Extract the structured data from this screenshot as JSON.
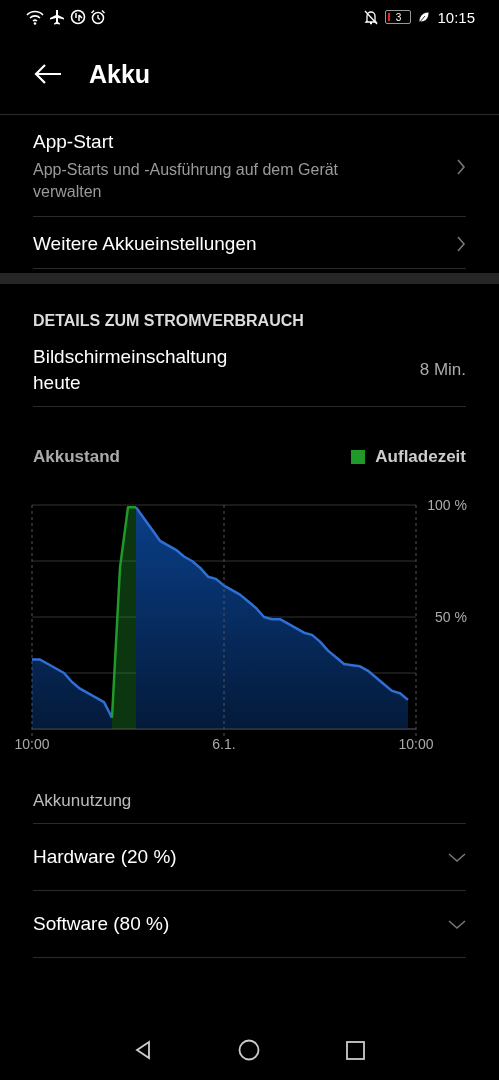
{
  "status_bar": {
    "time": "10:15",
    "battery": "3"
  },
  "header": {
    "title": "Akku"
  },
  "settings": [
    {
      "title": "App-Start",
      "subtitle": "App-Starts und -Ausführung auf dem Gerät verwalten"
    },
    {
      "title": "Weitere Akkueinstellungen"
    }
  ],
  "details": {
    "heading": "DETAILS ZUM STROMVERBRAUCH",
    "screen_on": {
      "label": "Bildschirmeinschaltung heute",
      "value": "8 Min."
    }
  },
  "battery_chart": {
    "chart_data": {
      "type": "area",
      "title": "Akkustand",
      "categories": [
        "10:00",
        null,
        null,
        null,
        null,
        null,
        null,
        null,
        null,
        null,
        null,
        null,
        null,
        null,
        null,
        null,
        null,
        null,
        null,
        null,
        null,
        null,
        null,
        null,
        "6.1.",
        null,
        null,
        null,
        null,
        null,
        null,
        null,
        null,
        null,
        null,
        null,
        null,
        null,
        null,
        null,
        null,
        null,
        null,
        null,
        null,
        null,
        null,
        null,
        "10:00"
      ],
      "series": [
        {
          "color": "#2f6fd6",
          "values": [
            31,
            31,
            29,
            27,
            25,
            21,
            18,
            16,
            14,
            12,
            5,
            null,
            null,
            99,
            94,
            89,
            84,
            82,
            80,
            77,
            75,
            72,
            68,
            67,
            64,
            62,
            60,
            57,
            54,
            50,
            49,
            49,
            47,
            45,
            43,
            42,
            39,
            35,
            32,
            29,
            28.5,
            28,
            26,
            23,
            20,
            17,
            16,
            13,
            null
          ]
        },
        {
          "name": "Aufladezeit",
          "color": "#1f9a2a",
          "values": [
            null,
            null,
            null,
            null,
            null,
            null,
            null,
            null,
            null,
            null,
            5,
            72,
            99,
            99,
            null,
            null,
            null,
            null,
            null,
            null,
            null,
            null,
            null,
            null,
            null,
            null,
            null,
            null,
            null,
            null,
            null,
            null,
            null,
            null,
            null,
            null,
            null,
            null,
            null,
            null,
            null,
            null,
            null,
            null,
            null,
            null,
            null,
            null,
            null
          ]
        }
      ],
      "ylim": [
        0,
        100
      ],
      "yticks": [
        {
          "value": 50,
          "label": "50 %"
        },
        {
          "value": 100,
          "label": "100 %"
        }
      ]
    }
  },
  "usage": {
    "heading": "Akkunutzung",
    "items": [
      {
        "label": "Hardware (20 %)",
        "expanded": false
      },
      {
        "label": "Software (80 %)",
        "expanded": false
      }
    ]
  }
}
